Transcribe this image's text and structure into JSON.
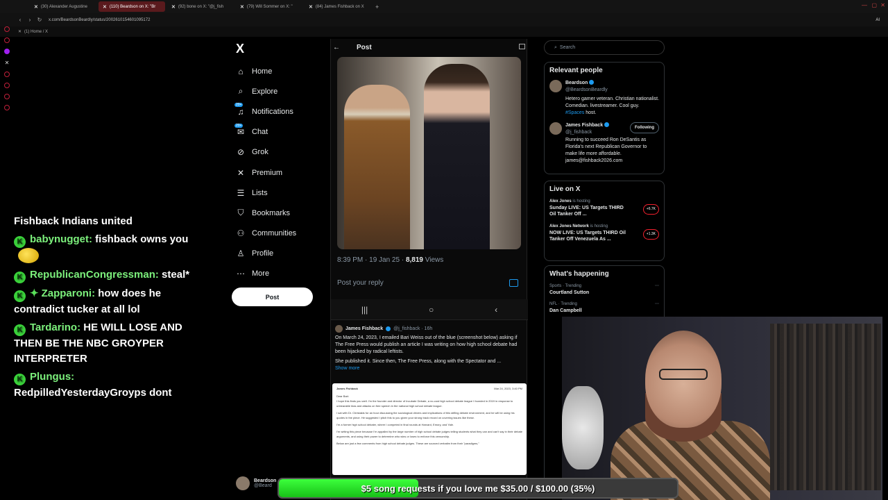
{
  "browser": {
    "tabs": [
      {
        "label": "(30) Alexander Augustine",
        "active": false
      },
      {
        "label": "(110) Beardson on X: \"Br",
        "active": true
      },
      {
        "label": "(92) bone on X: \"@j_fish",
        "active": false
      },
      {
        "label": "(79) Will Sommer on X: \"",
        "active": false
      },
      {
        "label": "(84) James Fishback on X",
        "active": false
      }
    ],
    "url": "x.com/BeardsonBeardly/status/2002610154601095172",
    "bookmark": "(1) Home / X",
    "ai_label": "AI"
  },
  "chat": {
    "messages": [
      {
        "user": "",
        "text": "Fishback Indians united"
      },
      {
        "user": "babynugget:",
        "text": "fishback owns you"
      },
      {
        "user": "RepublicanCongressman:",
        "text": "steal*"
      },
      {
        "user": "Zapparoni:",
        "text": "how does he contradict tucker at all lol"
      },
      {
        "user": "Tardarino:",
        "text": "HE WILL LOSE AND THEN BE THE NBC GROYPER INTERPRETER"
      },
      {
        "user": "Plungus:",
        "text": "RedpilledYesterdayGroyps dont"
      }
    ]
  },
  "nav": {
    "logo": "X",
    "items": [
      {
        "label": "Home",
        "icon": "home-icon",
        "glyph": "⌂"
      },
      {
        "label": "Explore",
        "icon": "search-icon",
        "glyph": "⌕"
      },
      {
        "label": "Notifications",
        "icon": "bell-icon",
        "glyph": "♫",
        "badge": "20+"
      },
      {
        "label": "Chat",
        "icon": "chat-icon",
        "glyph": "✉",
        "badge": "20+"
      },
      {
        "label": "Grok",
        "icon": "grok-icon",
        "glyph": "⊘"
      },
      {
        "label": "Premium",
        "icon": "x-premium-icon",
        "glyph": "✕"
      },
      {
        "label": "Lists",
        "icon": "list-icon",
        "glyph": "☰"
      },
      {
        "label": "Bookmarks",
        "icon": "bookmark-icon",
        "glyph": "⛉"
      },
      {
        "label": "Communities",
        "icon": "communities-icon",
        "glyph": "⚇"
      },
      {
        "label": "Profile",
        "icon": "profile-icon",
        "glyph": "♙"
      },
      {
        "label": "More",
        "icon": "more-icon",
        "glyph": "⋯"
      }
    ],
    "post_button": "Post",
    "account": {
      "name": "Beardson",
      "handle": "@Beard"
    }
  },
  "post": {
    "header": "Post",
    "time": "8:39 PM · 19 Jan 25 · ",
    "views_count": "8,819",
    "views_label": " Views",
    "reply_placeholder": "Post your reply",
    "quoted": {
      "name": "James Fishback",
      "handle": "@j_fishback · 16h",
      "text1": "On March 24, 2023, I emailed Bari Weiss out of the blue (screenshot below) asking if The Free Press would publish an article I was writing on how high school debate had been hijacked by radical leftists.",
      "text2": "She published it. Since then, The Free Press, along with the Spectator and ...",
      "show_more": "Show more"
    },
    "email": {
      "from": "James Fishback",
      "date": "Mar 24, 2023, 3:40 PM",
      "greeting": "Dear Bari:",
      "p1": "I hope this finds you well. I'm the founder and director of Incubate Debate, a no-cost high school debate league I founded in 2019 in response to unbearable bias and attacks on free speech in the national high school debate league.",
      "p2": "I sat with Dr. Christakis for an hour discussing the sociological drivers and implications of this stifling debate environment, and he will be using his quotes in the piece. He suggested I pitch this to you given your strong track record on covering issues like these.",
      "p3": "I'm a former high school debater, where I competed in final rounds at Harvard, Emory, and Yale.",
      "p4": "I'm writing this piece because I'm appalled by the large number of high school debate judges telling students what they can and can't say in their debate arguments, and using their power to determine who wins or loses to enforce this censorship.",
      "p5": "Below are just a few comments from high school debate judges. These are sourced verbatim from their \"paradigms,\""
    }
  },
  "sidebar": {
    "search_placeholder": "Search",
    "relevant_title": "Relevant people",
    "people": [
      {
        "name": "Beardson",
        "handle": "@BeardsonBeardly",
        "bio": "Hetero gamer veteran. Christian nationalist. Comedian. livestreamer. Cool guy. ",
        "hashtag": "#Spaces",
        "bio_end": " host."
      },
      {
        "name": "James Fishback",
        "handle": "@j_fishback",
        "follow": "Following",
        "bio": "Running to succeed Ron DeSantis as Florida's next Republican Governor to make life more affordable. james@fishback2026.com"
      }
    ],
    "live_title": "Live on X",
    "live": [
      {
        "host": "Alex Jones",
        "hosting": " is hosting",
        "title": "Sunday LIVE: US Targets THIRD Oil Tanker Off ...",
        "count": "+6.7K"
      },
      {
        "host": "Alex Jones Network",
        "hosting": " is hosting",
        "title": "NOW LIVE: US Targets THIRD Oil Tanker Off Venezuela As ...",
        "count": "+1.3K"
      }
    ],
    "happening_title": "What's happening",
    "trends": [
      {
        "category": "Sports · Trending",
        "name": "Courtland Sutton"
      },
      {
        "category": "NFL · Trending",
        "name": "Dan Campbell"
      }
    ]
  },
  "donation": {
    "text": "$5 song requests if you love me $35.00 / $100.00 (35%)",
    "progress": 0.35
  }
}
